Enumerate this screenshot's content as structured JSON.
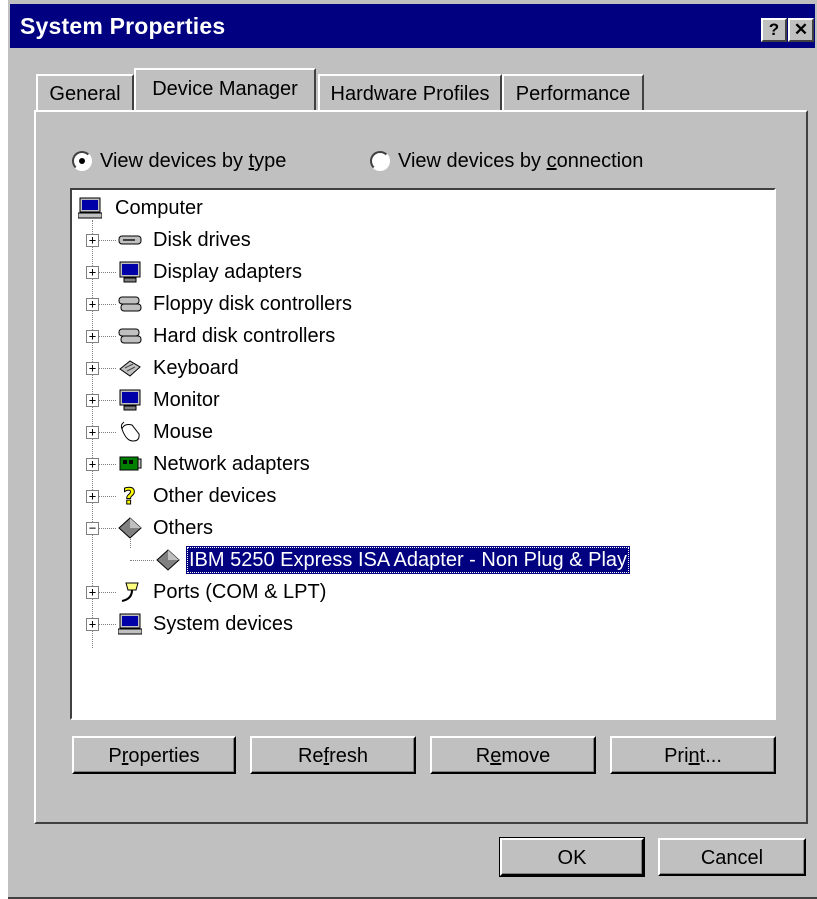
{
  "window": {
    "title": "System Properties",
    "help_button": "?",
    "close_button": "✕"
  },
  "tabs": [
    {
      "label": "General",
      "active": false
    },
    {
      "label": "Device Manager",
      "active": true
    },
    {
      "label": "Hardware Profiles",
      "active": false
    },
    {
      "label": "Performance",
      "active": false
    }
  ],
  "view_options": {
    "by_type": {
      "before": "View devices by ",
      "mnemonic": "t",
      "after": "ype",
      "selected": true
    },
    "by_connection": {
      "before": "View devices by ",
      "mnemonic": "c",
      "after": "onnection",
      "selected": false
    }
  },
  "tree": {
    "root": {
      "label": "Computer",
      "icon": "computer-icon"
    },
    "items": [
      {
        "label": "Disk drives",
        "icon": "disk-drive-icon",
        "expander": "+"
      },
      {
        "label": "Display adapters",
        "icon": "monitor-icon",
        "expander": "+"
      },
      {
        "label": "Floppy disk controllers",
        "icon": "controller-icon",
        "expander": "+"
      },
      {
        "label": "Hard disk controllers",
        "icon": "controller-icon",
        "expander": "+"
      },
      {
        "label": "Keyboard",
        "icon": "keyboard-icon",
        "expander": "+"
      },
      {
        "label": "Monitor",
        "icon": "monitor-icon",
        "expander": "+"
      },
      {
        "label": "Mouse",
        "icon": "mouse-icon",
        "expander": "+"
      },
      {
        "label": "Network adapters",
        "icon": "network-card-icon",
        "expander": "+"
      },
      {
        "label": "Other devices",
        "icon": "question-mark-icon",
        "expander": "+"
      },
      {
        "label": "Others",
        "icon": "diamond-icon",
        "expander": "−"
      },
      {
        "label": "IBM 5250 Express ISA Adapter - Non Plug & Play",
        "icon": "diamond-icon",
        "child": true,
        "selected": true
      },
      {
        "label": "Ports (COM & LPT)",
        "icon": "port-icon",
        "expander": "+"
      },
      {
        "label": "System devices",
        "icon": "computer-icon",
        "expander": "+"
      }
    ]
  },
  "buttons": {
    "properties": {
      "before": "P",
      "mnemonic": "r",
      "after": "operties"
    },
    "refresh": {
      "before": "Re",
      "mnemonic": "f",
      "after": "resh"
    },
    "remove": {
      "before": "R",
      "mnemonic": "e",
      "after": "move"
    },
    "print": {
      "before": "Pri",
      "mnemonic": "n",
      "after": "t..."
    },
    "ok": "OK",
    "cancel": "Cancel"
  },
  "colors": {
    "titlebar": "#000080",
    "face": "#c0c0c0",
    "selection": "#000080"
  }
}
